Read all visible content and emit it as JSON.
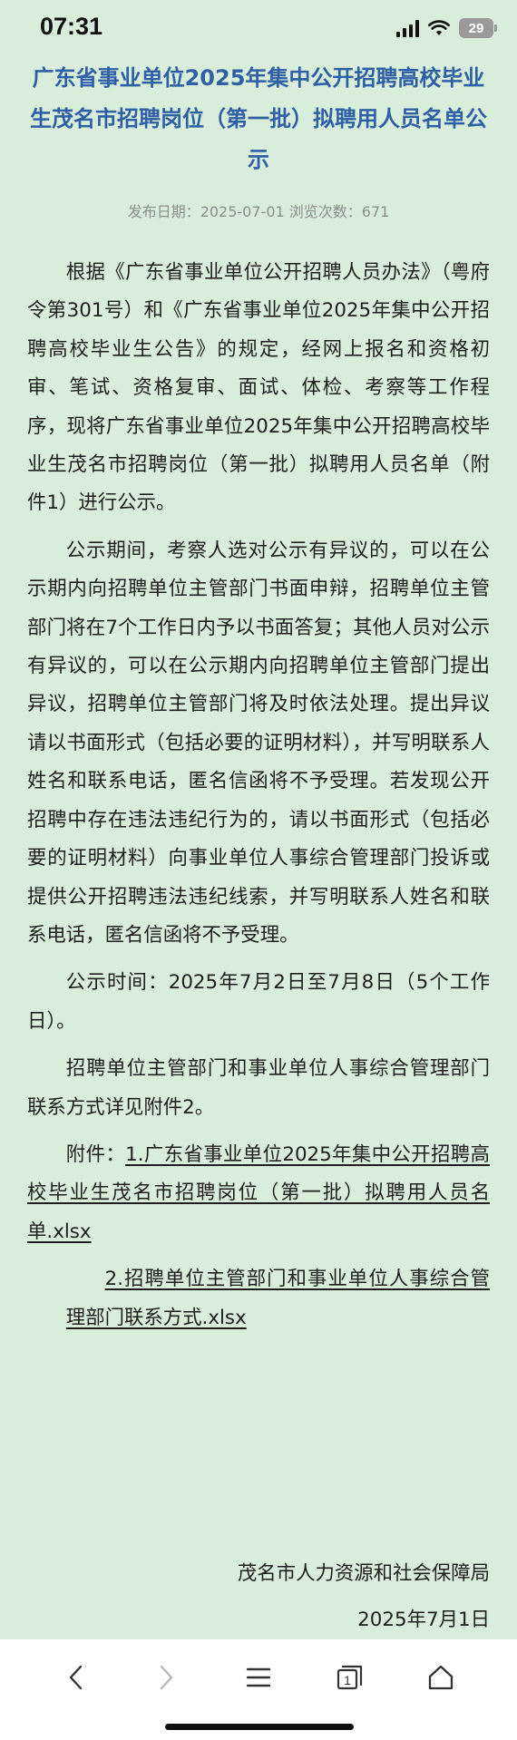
{
  "status_bar": {
    "time": "07:31",
    "battery": "29"
  },
  "article": {
    "title": "广东省事业单位2025年集中公开招聘高校毕业生茂名市招聘岗位（第一批）拟聘用人员名单公示",
    "meta": "发布日期：2025-07-01 浏览次数：671",
    "paragraphs": [
      "根据《广东省事业单位公开招聘人员办法》（粤府令第301号）和《广东省事业单位2025年集中公开招聘高校毕业生公告》的规定，经网上报名和资格初审、笔试、资格复审、面试、体检、考察等工作程序，现将广东省事业单位2025年集中公开招聘高校毕业生茂名市招聘岗位（第一批）拟聘用人员名单（附件1）进行公示。",
      "公示期间，考察人选对公示有异议的，可以在公示期内向招聘单位主管部门书面申辩，招聘单位主管部门将在7个工作日内予以书面答复；其他人员对公示有异议的，可以在公示期内向招聘单位主管部门提出异议，招聘单位主管部门将及时依法处理。提出异议请以书面形式（包括必要的证明材料），并写明联系人姓名和联系电话，匿名信函将不予受理。若发现公开招聘中存在违法违纪行为的，请以书面形式（包括必要的证明材料）向事业单位人事综合管理部门投诉或提供公开招聘违法违纪线索，并写明联系人姓名和联系电话，匿名信函将不予受理。",
      "公示时间：2025年7月2日至7月8日（5个工作日）。",
      "招聘单位主管部门和事业单位人事综合管理部门联系方式详见附件2。"
    ],
    "attachments_label": "附件：",
    "attachments": [
      "1.广东省事业单位2025年集中公开招聘高校毕业生茂名市招聘岗位（第一批）拟聘用人员名单.xlsx",
      "2.招聘单位主管部门和事业单位人事综合管理部门联系方式.xlsx"
    ],
    "signature_org": "茂名市人力资源和社会保障局",
    "signature_date": "2025年7月1日"
  },
  "browser_bar": {
    "icons": [
      "back-icon",
      "forward-icon",
      "menu-icon",
      "tabs-icon",
      "home-icon"
    ],
    "tab_count": "1"
  },
  "colors": {
    "background": "#d8eedb",
    "title": "#2f5fa5",
    "meta": "#8a8f8c",
    "text": "#1e1e1e"
  }
}
